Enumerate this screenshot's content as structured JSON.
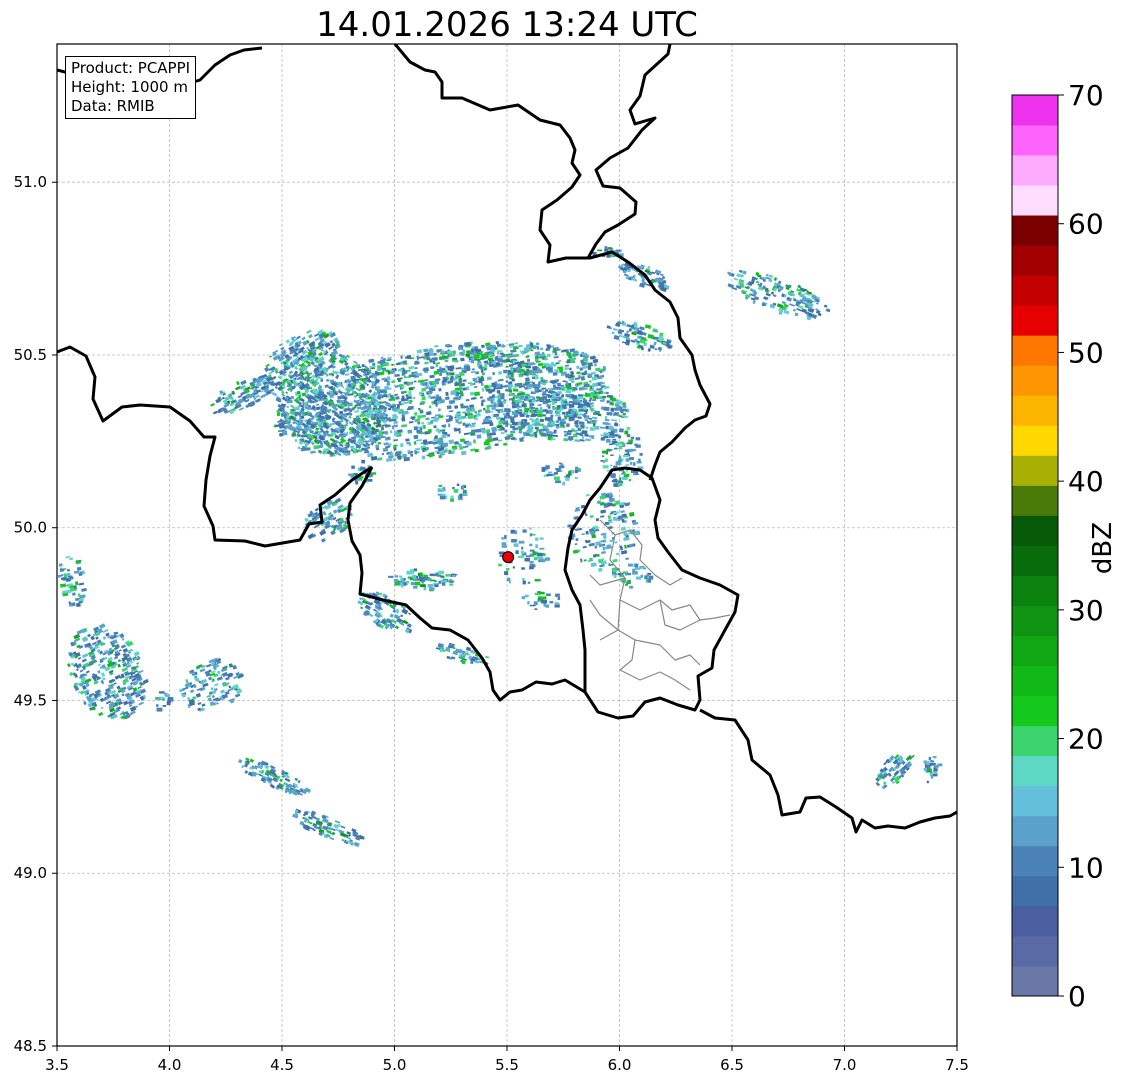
{
  "title": "14.01.2026 13:24 UTC",
  "info": {
    "product": "Product: PCAPPI",
    "height": "Height: 1000 m",
    "data": "Data: RMIB"
  },
  "map": {
    "lon_range": [
      3.5,
      7.5
    ],
    "lat_range": [
      48.5,
      51.4
    ],
    "x_ticks": [
      "3.5",
      "4.0",
      "4.5",
      "5.0",
      "5.5",
      "6.0",
      "6.5",
      "7.0",
      "7.5"
    ],
    "y_ticks": [
      "48.5",
      "49.0",
      "49.5",
      "50.0",
      "50.5",
      "51.0"
    ],
    "grid": true,
    "radar_site": {
      "lon": 5.505,
      "lat": 49.915,
      "color": "#e8000b"
    }
  },
  "colorbar": {
    "label": "dBZ",
    "ticks": [
      "0",
      "10",
      "20",
      "30",
      "40",
      "50",
      "60",
      "70"
    ],
    "range": [
      0,
      70
    ],
    "colors": [
      "#6a78a8",
      "#5a6aa4",
      "#4a5ea0",
      "#4070a8",
      "#4a82b8",
      "#5aa2cc",
      "#64c0da",
      "#5cd8c4",
      "#3cd46c",
      "#14c81c",
      "#10b818",
      "#10a614",
      "#0e9412",
      "#0c820e",
      "#086c0a",
      "#065a08",
      "#4a7a08",
      "#a8b004",
      "#fed800",
      "#fdb600",
      "#fd9600",
      "#fd7800",
      "#e60000",
      "#c40000",
      "#a20000",
      "#7a0000",
      "#fedcfe",
      "#fcaafc",
      "#fc64fc",
      "#ee32ee"
    ]
  }
}
